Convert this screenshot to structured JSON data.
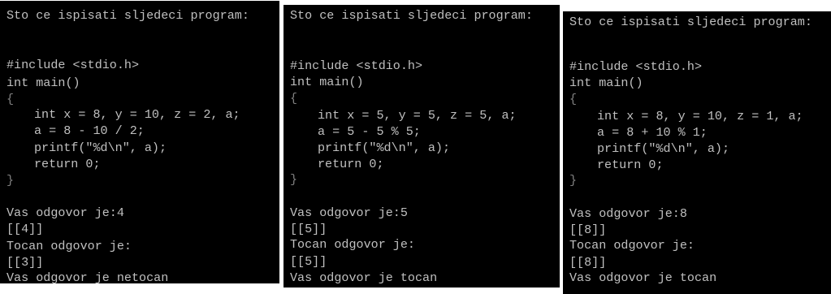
{
  "panels": [
    {
      "title": "Sto ce ispisati sljedeci program:",
      "include": "#include <stdio.h>",
      "main": "int main()",
      "open_brace": "{",
      "code": [
        "int x = 8, y = 10, z = 2, a;",
        "a = 8 - 10 / 2;",
        "printf(\"%d\\n\", a);",
        "return 0;"
      ],
      "close_brace": "}",
      "your_answer_label": "Vas odgovor je:4",
      "your_answer_value": "[[4]]",
      "correct_label": "Tocan odgovor je:",
      "correct_value": "[[3]]",
      "result": "Vas odgovor je netocan"
    },
    {
      "title": "Sto ce ispisati sljedeci program:",
      "include": "#include <stdio.h>",
      "main": "int main()",
      "open_brace": "{",
      "code": [
        "int x = 5, y = 5, z = 5, a;",
        "a = 5 - 5 % 5;",
        "printf(\"%d\\n\", a);",
        "return 0;"
      ],
      "close_brace": "}",
      "your_answer_label": "Vas odgovor je:5",
      "your_answer_value": "[[5]]",
      "correct_label": "Tocan odgovor je:",
      "correct_value": "[[5]]",
      "result": "Vas odgovor je tocan"
    },
    {
      "title": "Sto ce ispisati sljedeci program:",
      "include": "#include <stdio.h>",
      "main": "int main()",
      "open_brace": "{",
      "code": [
        "int x = 8, y = 10, z = 1, a;",
        "a = 8 + 10 % 1;",
        "printf(\"%d\\n\", a);",
        "return 0;"
      ],
      "close_brace": "}",
      "your_answer_label": "Vas odgovor je:8",
      "your_answer_value": "[[8]]",
      "correct_label": "Tocan odgovor je:",
      "correct_value": "[[8]]",
      "result": "Vas odgovor je tocan"
    }
  ]
}
